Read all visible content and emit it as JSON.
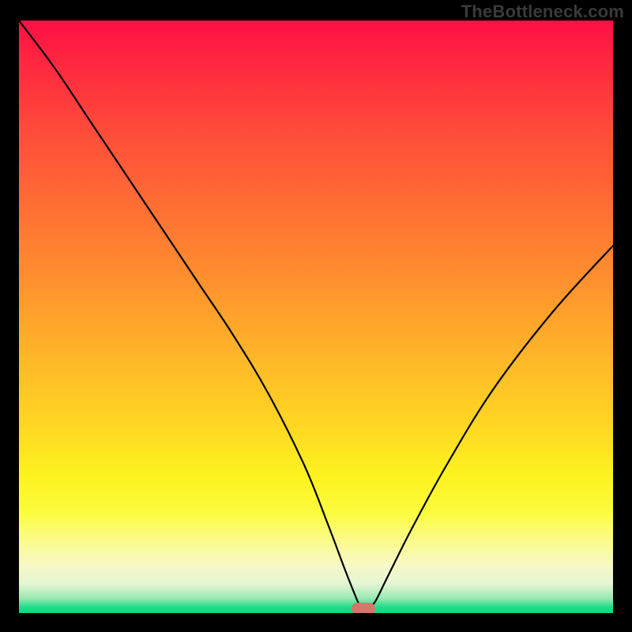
{
  "watermark": "TheBottleneck.com",
  "marker": {
    "x_pct": 58,
    "color": "#d6756a"
  },
  "chart_data": {
    "type": "line",
    "title": "",
    "xlabel": "",
    "ylabel": "",
    "xlim": [
      0,
      100
    ],
    "ylim": [
      0,
      100
    ],
    "grid": false,
    "series": [
      {
        "name": "bottleneck-curve",
        "x": [
          0,
          6,
          12,
          18,
          24,
          30,
          36,
          42,
          48,
          52,
          55,
          57,
          58,
          59,
          60,
          62,
          66,
          72,
          80,
          90,
          100
        ],
        "values": [
          100,
          92,
          83,
          74,
          65,
          56,
          47,
          37,
          25,
          15,
          7,
          2,
          0,
          1,
          2,
          6,
          14,
          25,
          38,
          51,
          62
        ]
      }
    ],
    "annotations": [
      {
        "type": "marker",
        "x": 58,
        "label": "optimal-point"
      }
    ],
    "background": {
      "type": "vertical-gradient",
      "stops": [
        {
          "pct": 0,
          "color": "#ff1045"
        },
        {
          "pct": 50,
          "color": "#ffa52c"
        },
        {
          "pct": 80,
          "color": "#fdf31f"
        },
        {
          "pct": 100,
          "color": "#0adb82"
        }
      ]
    }
  }
}
